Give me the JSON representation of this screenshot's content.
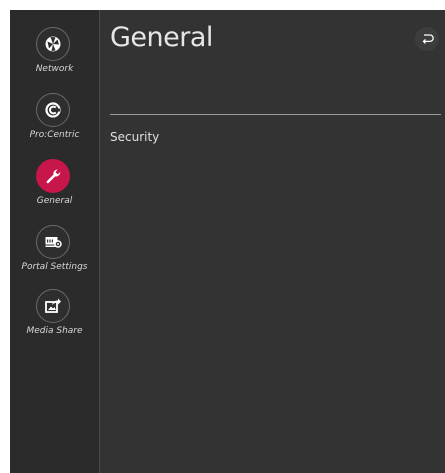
{
  "header": {
    "title": "General"
  },
  "sidebar": {
    "items": [
      {
        "label": "Network",
        "icon": "network-icon"
      },
      {
        "label": "Pro:Centric",
        "icon": "procentric-icon"
      },
      {
        "label": "General",
        "icon": "wrench-icon",
        "active": true
      },
      {
        "label": "Portal Settings",
        "icon": "portal-settings-icon"
      },
      {
        "label": "Media Share",
        "icon": "media-share-icon"
      }
    ]
  },
  "main": {
    "items": [
      {
        "label": "Security"
      }
    ]
  },
  "colors": {
    "accent": "#c6164a",
    "background": "#333333",
    "sidebar": "#2b2b2b"
  }
}
